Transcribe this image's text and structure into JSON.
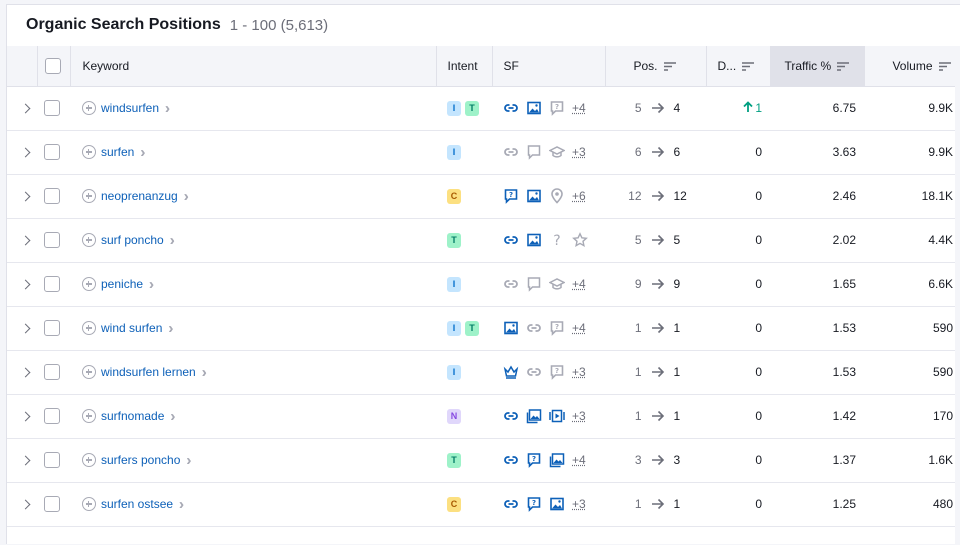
{
  "header": {
    "title": "Organic Search Positions",
    "range": "1 - 100 (5,613)"
  },
  "columns": {
    "keyword": "Keyword",
    "intent": "Intent",
    "sf": "SF",
    "pos": "Pos.",
    "diff": "D...",
    "traffic": "Traffic %",
    "volume": "Volume"
  },
  "rows": [
    {
      "keyword": "windsurfen",
      "intents": [
        "I",
        "T"
      ],
      "sf": [
        "link",
        "image",
        "faq-gray"
      ],
      "more": "+4",
      "pos_from": "5",
      "pos_to": "4",
      "diff": "1",
      "diff_up": true,
      "traffic": "6.75",
      "volume": "9.9K"
    },
    {
      "keyword": "surfen",
      "intents": [
        "I"
      ],
      "sf": [
        "link-gray",
        "review-gray",
        "cap-gray"
      ],
      "more": "+3",
      "pos_from": "6",
      "pos_to": "6",
      "diff": "0",
      "diff_up": false,
      "traffic": "3.63",
      "volume": "9.9K"
    },
    {
      "keyword": "neoprenanzug",
      "intents": [
        "C"
      ],
      "sf": [
        "faq",
        "image",
        "pin-gray"
      ],
      "more": "+6",
      "pos_from": "12",
      "pos_to": "12",
      "diff": "0",
      "diff_up": false,
      "traffic": "2.46",
      "volume": "18.1K"
    },
    {
      "keyword": "surf poncho",
      "intents": [
        "T"
      ],
      "sf": [
        "link",
        "image",
        "question-gray",
        "star-gray"
      ],
      "more": "",
      "pos_from": "5",
      "pos_to": "5",
      "diff": "0",
      "diff_up": false,
      "traffic": "2.02",
      "volume": "4.4K"
    },
    {
      "keyword": "peniche",
      "intents": [
        "I"
      ],
      "sf": [
        "link-gray",
        "review-gray",
        "cap-gray"
      ],
      "more": "+4",
      "pos_from": "9",
      "pos_to": "9",
      "diff": "0",
      "diff_up": false,
      "traffic": "1.65",
      "volume": "6.6K"
    },
    {
      "keyword": "wind surfen",
      "intents": [
        "I",
        "T"
      ],
      "sf": [
        "image",
        "link-gray",
        "faq-gray"
      ],
      "more": "+4",
      "pos_from": "1",
      "pos_to": "1",
      "diff": "0",
      "diff_up": false,
      "traffic": "1.53",
      "volume": "590"
    },
    {
      "keyword": "windsurfen lernen",
      "intents": [
        "I"
      ],
      "sf": [
        "crown",
        "link-gray",
        "faq-gray"
      ],
      "more": "+3",
      "pos_from": "1",
      "pos_to": "1",
      "diff": "0",
      "diff_up": false,
      "traffic": "1.53",
      "volume": "590"
    },
    {
      "keyword": "surfnomade",
      "intents": [
        "N"
      ],
      "sf": [
        "link",
        "gallery",
        "video"
      ],
      "more": "+3",
      "pos_from": "1",
      "pos_to": "1",
      "diff": "0",
      "diff_up": false,
      "traffic": "1.42",
      "volume": "170"
    },
    {
      "keyword": "surfers poncho",
      "intents": [
        "T"
      ],
      "sf": [
        "link",
        "faq",
        "gallery"
      ],
      "more": "+4",
      "pos_from": "3",
      "pos_to": "3",
      "diff": "0",
      "diff_up": false,
      "traffic": "1.37",
      "volume": "1.6K"
    },
    {
      "keyword": "surfen ostsee",
      "intents": [
        "C"
      ],
      "sf": [
        "link",
        "faq",
        "image"
      ],
      "more": "+3",
      "pos_from": "1",
      "pos_to": "1",
      "diff": "0",
      "diff_up": false,
      "traffic": "1.25",
      "volume": "480"
    }
  ],
  "colors": {
    "link": "#0d60b8",
    "muted": "#a8aab5",
    "up": "#009f81"
  }
}
